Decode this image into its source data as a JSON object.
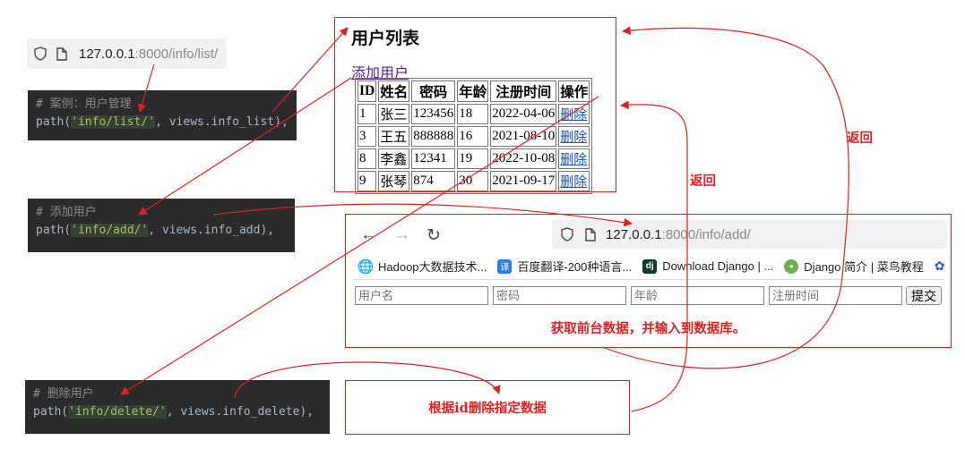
{
  "url_top": {
    "host": "127.0.0.1",
    "path": ":8000/info/list/"
  },
  "code_list": {
    "comment": "# 案例：用户管理",
    "prefix": "path(",
    "route": "'info/list/'",
    "suffix": ", views.info_list),"
  },
  "code_add": {
    "comment": "# 添加用户",
    "prefix": "path(",
    "route": "'info/add/'",
    "suffix": ", views.info_add),"
  },
  "code_delete": {
    "comment": "# 删除用户",
    "prefix": "path(",
    "route": "'info/delete/'",
    "suffix": ", views.info_delete),"
  },
  "user_list": {
    "title": "用户列表",
    "add_link": "添加用户",
    "headers": [
      "ID",
      "姓名",
      "密码",
      "年龄",
      "注册时间",
      "操作"
    ],
    "rows": [
      {
        "id": "1",
        "name": "张三",
        "password": "123456",
        "age": "18",
        "reg_time": "2022-04-06",
        "action": "删除"
      },
      {
        "id": "3",
        "name": "王五",
        "password": "888888",
        "age": "16",
        "reg_time": "2021-08-10",
        "action": "删除"
      },
      {
        "id": "8",
        "name": "李鑫",
        "password": "12341",
        "age": "19",
        "reg_time": "2022-10-08",
        "action": "删除"
      },
      {
        "id": "9",
        "name": "张琴",
        "password": "874",
        "age": "30",
        "reg_time": "2021-09-17",
        "action": "删除"
      }
    ]
  },
  "add_page": {
    "url_host": "127.0.0.1",
    "url_path": ":8000/info/add/",
    "bookmarks": [
      "Hadoop大数据技术...",
      "百度翻译-200种语言...",
      "Download Django | ...",
      "Django 简介 | 菜鸟教程"
    ],
    "placeholders": {
      "username": "用户名",
      "password": "密码",
      "age": "年龄",
      "reg_time": "注册时间"
    },
    "submit_label": "提交",
    "note": "获取前台数据，并输入到数据库。"
  },
  "delete_note": "根据id删除指定数据",
  "return_label_1": "返回",
  "return_label_2": "返回",
  "colors": {
    "annotation": "#e02020",
    "code_bg": "#2b2b2b",
    "link": "#1a52c8",
    "visited_link": "#5a1f8f"
  }
}
